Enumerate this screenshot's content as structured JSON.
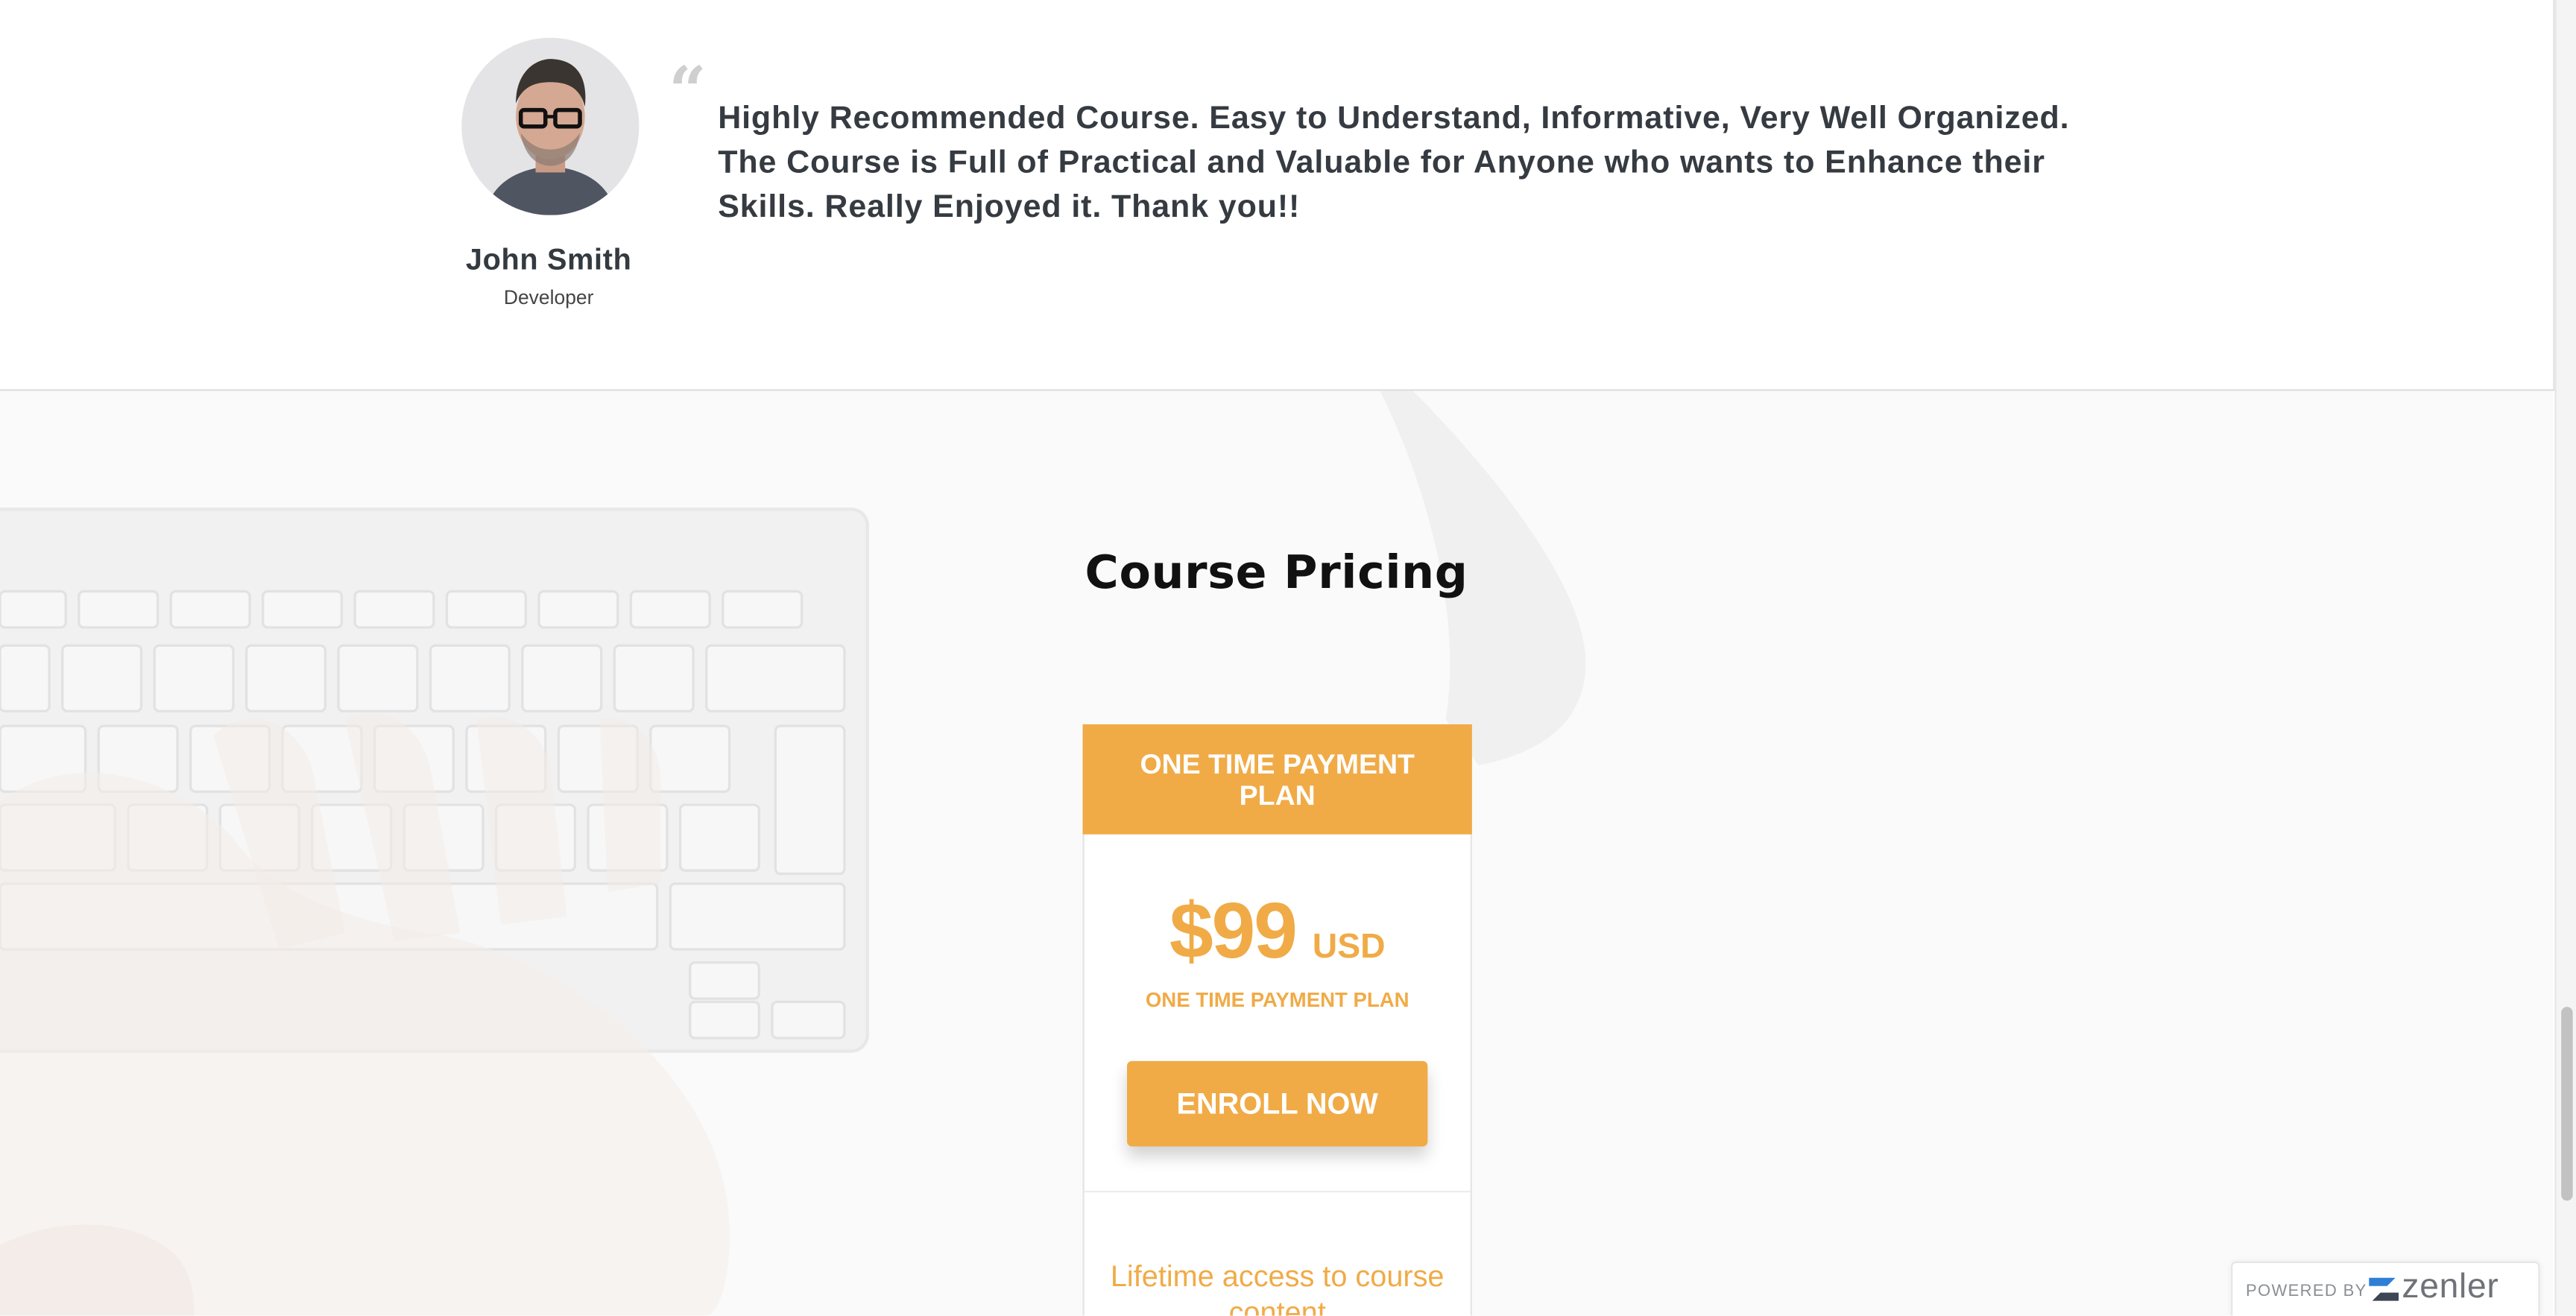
{
  "testimonial": {
    "quote": "Highly Recommended Course. Easy to Understand, Informative, Very Well Organized. The Course is Full of Practical and Valuable for Anyone who wants to Enhance their Skills. Really Enjoyed it. Thank you!!",
    "name": "John Smith",
    "role": "Developer"
  },
  "pricing": {
    "title": "Course Pricing",
    "plan": {
      "header": "ONE TIME PAYMENT PLAN",
      "price": "$99",
      "currency": "USD",
      "subtitle": "ONE TIME PAYMENT PLAN",
      "cta_label": "ENROLL NOW",
      "feature": "Lifetime access to course content"
    }
  },
  "badge": {
    "powered_by": "POWERED BY",
    "brand": "zenler"
  },
  "colors": {
    "accent": "#f0ab47",
    "text_dark": "#353b41"
  }
}
